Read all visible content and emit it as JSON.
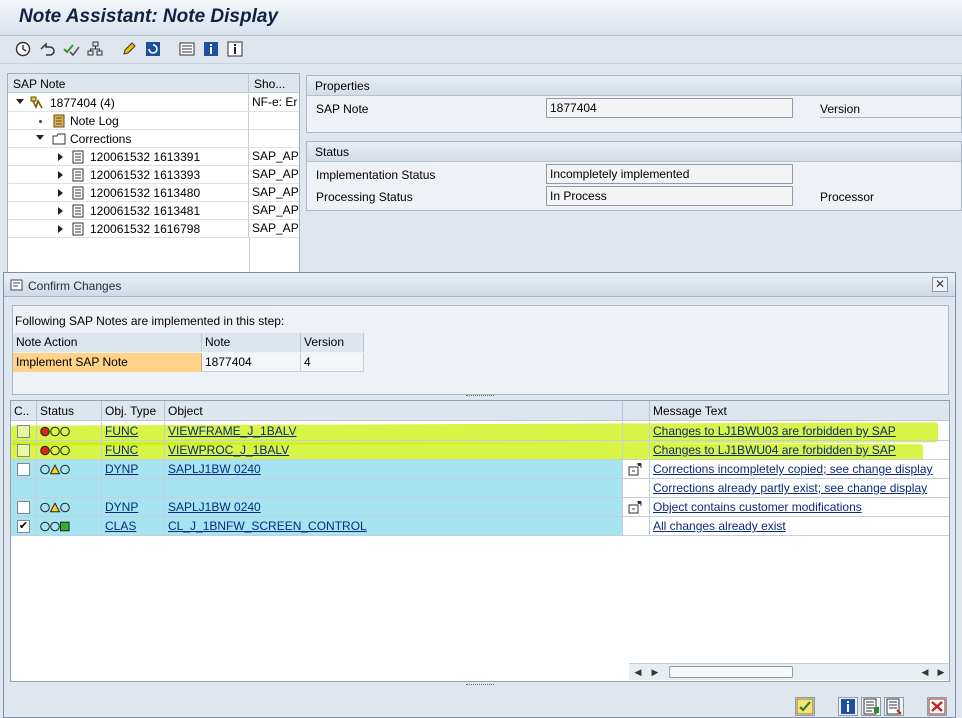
{
  "app": {
    "title": "Note Assistant: Note Display"
  },
  "toolbar": {
    "icons": [
      "clock-check-icon",
      "undo-arrow-icon",
      "checkmarks-icon",
      "hierarchy-icon",
      "pencil-icon",
      "refresh-icon",
      "list-icon",
      "info-icon",
      "info-dark-icon"
    ]
  },
  "tree": {
    "headers": [
      "SAP Note",
      "Sho..."
    ],
    "rows": [
      {
        "label": "1877404 (4)",
        "short": "NF-e: Er",
        "icon": "note-icon"
      },
      {
        "label": "Note Log",
        "short": "",
        "icon": "log-icon"
      },
      {
        "label": "Corrections",
        "short": "",
        "icon": "folder-icon"
      },
      {
        "label": "120061532 1613391",
        "short": "SAP_AP",
        "icon": "document-icon"
      },
      {
        "label": "120061532 1613393",
        "short": "SAP_AP",
        "icon": "document-icon"
      },
      {
        "label": "120061532 1613480",
        "short": "SAP_AP",
        "icon": "document-icon"
      },
      {
        "label": "120061532 1613481",
        "short": "SAP_AP",
        "icon": "document-icon"
      },
      {
        "label": "120061532 1616798",
        "short": "SAP_AP",
        "icon": "document-icon"
      }
    ]
  },
  "properties": {
    "title": "Properties",
    "sap_note_label": "SAP Note",
    "sap_note_value": "1877404",
    "version_label": "Version"
  },
  "status": {
    "title": "Status",
    "impl_label": "Implementation Status",
    "impl_value": "Incompletely implemented",
    "proc_label": "Processing Status",
    "proc_value": "In Process",
    "processor_label": "Processor"
  },
  "dialog": {
    "title": "Confirm Changes",
    "intro": "Following SAP Notes are implemented in this step:",
    "notes_headers": [
      "Note Action",
      "Note",
      "Version"
    ],
    "notes_row": [
      "Implement SAP Note",
      "1877404",
      "4"
    ],
    "obj_headers": [
      "C..",
      "Status",
      "Obj. Type",
      "Object",
      "",
      "Message Text"
    ],
    "obj_rows": [
      {
        "checked": false,
        "status": "red",
        "type": "FUNC",
        "object": "VIEWFRAME_J_1BALV",
        "msg": "Changes to LJ1BWU03 are forbidden by SAP",
        "highlight": true,
        "edit_icon": false
      },
      {
        "checked": false,
        "status": "red",
        "type": "FUNC",
        "object": "VIEWPROC_J_1BALV",
        "msg": "Changes to LJ1BWU04 are forbidden by SAP",
        "highlight": true,
        "edit_icon": false
      },
      {
        "checked": false,
        "status": "yellow",
        "type": "DYNP",
        "object": "SAPLJ1BW 0240",
        "msg": "Corrections incompletely copied; see change display",
        "highlight": false,
        "edit_icon": true
      },
      {
        "checked": null,
        "status": "",
        "type": "",
        "object": "",
        "msg": "Corrections already partly exist; see change display",
        "highlight": false,
        "edit_icon": false
      },
      {
        "checked": false,
        "status": "yellow",
        "type": "DYNP",
        "object": "SAPLJ1BW 0240",
        "msg": "Object contains customer modifications",
        "highlight": false,
        "edit_icon": true
      },
      {
        "checked": true,
        "status": "green",
        "type": "CLAS",
        "object": "CL_J_1BNFW_SCREEN_CONTROL",
        "msg": "All changes already exist",
        "highlight": false,
        "edit_icon": false
      }
    ],
    "check_mark": "✔",
    "buttons": [
      "confirm-check-icon",
      "info-icon",
      "doc-list-icon",
      "doc-detail-icon",
      "cancel-x-icon"
    ]
  },
  "colors": {
    "highlight": "#c8f000",
    "row_cyan": "#a6e4f2",
    "note_action_cell": "#ffd28a",
    "title_text": "#0d2344"
  }
}
